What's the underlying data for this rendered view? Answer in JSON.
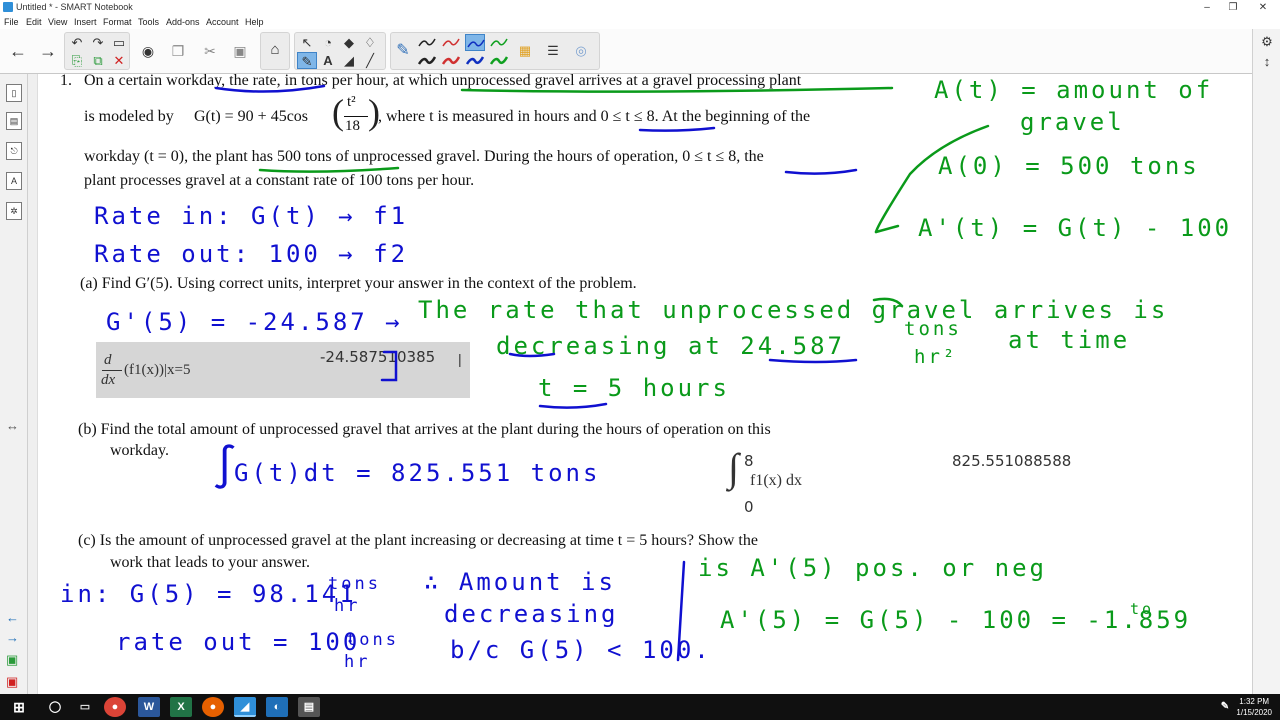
{
  "window": {
    "title": "Untitled * - SMART Notebook",
    "controls": [
      "–",
      "❐",
      "✕"
    ]
  },
  "menu": [
    "File",
    "Edit",
    "View",
    "Insert",
    "Format",
    "Tools",
    "Add-ons",
    "Account",
    "Help"
  ],
  "problem": {
    "number": "1.",
    "intro_line1": "On a certain workday, the rate, in tons per hour, at which unprocessed gravel arrives at a gravel processing plant",
    "intro_line2_a": "is modeled by",
    "intro_line2_eq": "G(t) = 90 + 45cos",
    "frac_num": "t²",
    "frac_den": "18",
    "intro_line2_b": ", where t is measured in hours and 0 ≤ t ≤ 8. At the beginning of the",
    "intro_line3": "workday (t = 0), the plant has 500 tons of unprocessed gravel. During the hours of operation, 0 ≤ t ≤ 8, the",
    "intro_line4": "plant processes gravel at a constant rate of 100 tons per hour.",
    "part_a": "(a)  Find G′(5). Using correct units, interpret your answer in the context of the problem.",
    "part_b_line1": "(b)  Find the total amount of unprocessed gravel that arrives at the plant during the hours of operation on this",
    "part_b_line2": "workday.",
    "part_c_line1": "(c)  Is the amount of unprocessed gravel at the plant increasing or decreasing at time t = 5 hours? Show the",
    "part_c_line2": "work that leads to your answer."
  },
  "calculator": {
    "deriv_top": "d",
    "deriv_bottom": "dx",
    "deriv_expr": "(f1(x))|x=5",
    "deriv_result": "-24.587510385",
    "int_upper": "8",
    "int_lower": "0",
    "int_expr": "f1(x) dx",
    "int_result": "825.551088588"
  },
  "handwriting": {
    "rate_in": "Rate in: G(t) → f1",
    "rate_out": "Rate out: 100 → f2",
    "g_prime": "G'(5) = -24.587 →",
    "interp1": "The rate that unprocessed gravel arrives is",
    "interp2": "decreasing at 24.587",
    "interp_units_num": "tons",
    "interp_units_den": "hr²",
    "interp_at": "at time",
    "interp3": "t = 5  hours",
    "integral_ans": "G(t)dt = 825.551 tons",
    "at_def1": "A(t) = amount of",
    "at_def2": "gravel",
    "a0": "A(0) = 500 tons",
    "a_prime": "A'(t) = G(t) - 100",
    "in_g5": "in: G(5) = 98.141",
    "units_tons": "tons",
    "units_hr": "hr",
    "rate_out_c": "rate out = 100",
    "therefore": "∴ Amount is",
    "decreasing": "decreasing",
    "because": "b/c G(5) < 100.",
    "question": "is A'(5) pos. or neg",
    "a5": "A'(5) = G(5) - 100 = -1.859",
    "a5_units": "to"
  },
  "taskbar": {
    "time": "1:32 PM",
    "date": "1/15/2020"
  },
  "colors": {
    "blue_ink": "#1010d0",
    "green_ink": "#0a9a1a",
    "accent": "#2f8fd8"
  }
}
